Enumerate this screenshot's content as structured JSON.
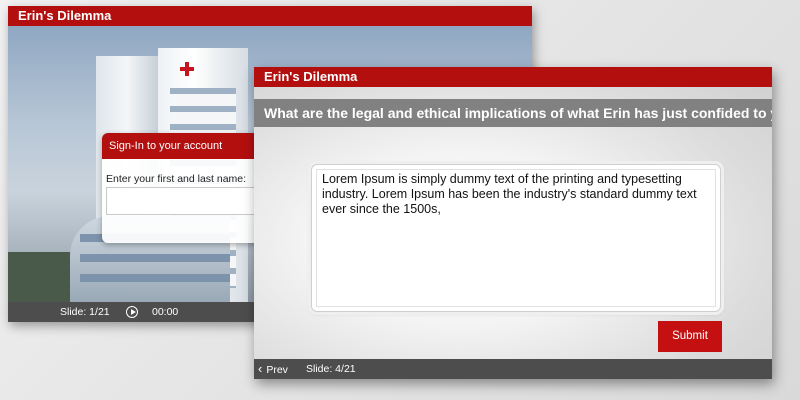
{
  "back_window": {
    "title": "Erin's Dilemma",
    "signin": {
      "heading": "Sign-In to your account",
      "name_label": "Enter your first and last name:",
      "name_value": ""
    },
    "footer": {
      "slide": "Slide: 1/21",
      "play_icon": "play-circle-icon",
      "time": "00:00"
    }
  },
  "front_window": {
    "title": "Erin's Dilemma",
    "question": "What are the legal and ethical implications of what Erin has just confided to you?",
    "answer_text": "Lorem Ipsum is simply dummy text of the printing and typesetting industry. Lorem Ipsum has been the industry's standard dummy text ever since the 1500s,",
    "submit_label": "Submit",
    "footer": {
      "prev_label": "Prev",
      "prev_icon": "chevron-left-icon",
      "slide": "Slide: 4/21"
    }
  },
  "colors": {
    "brand_red": "#b30f0f",
    "submit_red": "#c41010",
    "question_bar": "#818181",
    "footer_bar": "#4d4d4d"
  }
}
